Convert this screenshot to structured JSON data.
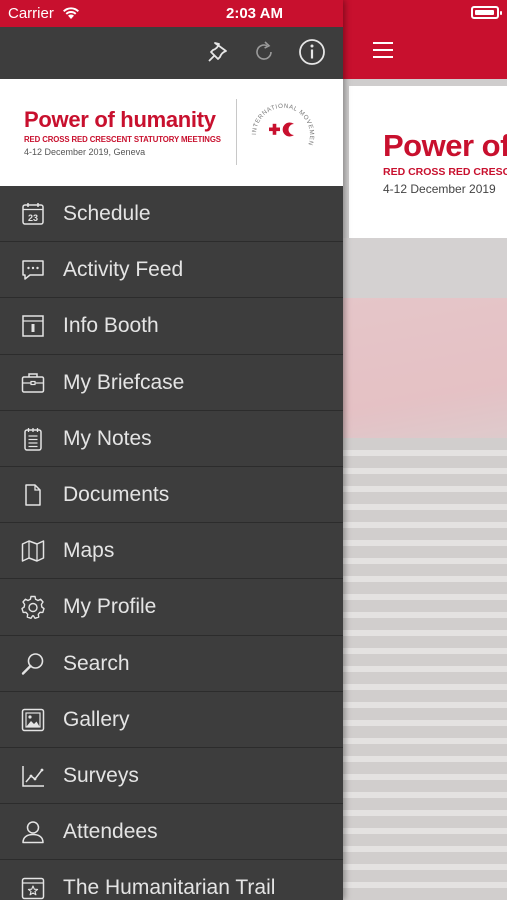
{
  "status": {
    "carrier": "Carrier",
    "time": "2:03 AM"
  },
  "toolbar": {
    "icons": [
      "pin-icon",
      "refresh-icon",
      "info-icon"
    ]
  },
  "banner": {
    "title": "Power of humanity",
    "subtitle": "RED CROSS RED CRESCENT STATUTORY MEETINGS",
    "dates": "4-12 December 2019, Geneva",
    "emblem_text": "INTERNATIONAL MOVEMENT"
  },
  "main_banner": {
    "title": "Power of",
    "subtitle": "RED CROSS RED CRESC",
    "dates": "4-12 December 2019"
  },
  "menu": {
    "items": [
      {
        "label": "Schedule",
        "icon": "calendar-icon"
      },
      {
        "label": "Activity Feed",
        "icon": "chat-icon"
      },
      {
        "label": "Info Booth",
        "icon": "booth-icon"
      },
      {
        "label": "My Briefcase",
        "icon": "briefcase-icon"
      },
      {
        "label": "My Notes",
        "icon": "notes-icon"
      },
      {
        "label": "Documents",
        "icon": "document-icon"
      },
      {
        "label": "Maps",
        "icon": "map-icon"
      },
      {
        "label": "My Profile",
        "icon": "gear-icon"
      },
      {
        "label": "Search",
        "icon": "search-icon"
      },
      {
        "label": "Gallery",
        "icon": "gallery-icon"
      },
      {
        "label": "Surveys",
        "icon": "chart-icon"
      },
      {
        "label": "Attendees",
        "icon": "person-icon"
      },
      {
        "label": "The Humanitarian Trail",
        "icon": "trail-icon"
      }
    ],
    "calendar_day": "23"
  },
  "colors": {
    "brand_red": "#c8102e",
    "drawer_bg": "#3d3d3d",
    "menu_text": "#e4e4e4"
  }
}
